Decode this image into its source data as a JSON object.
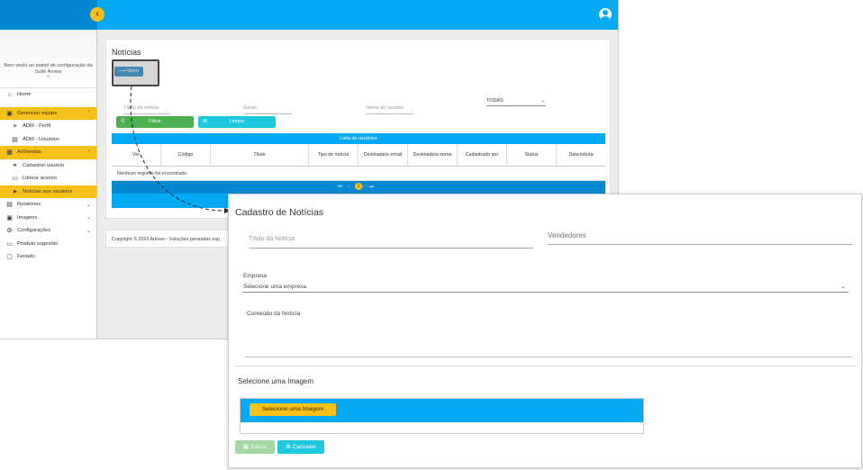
{
  "sidebar": {
    "welcome": "Bem vindo ao painel de configuração da Suite Arnew",
    "items": [
      {
        "label": "Home",
        "icon": "home-icon",
        "glyph": "⌂"
      },
      {
        "label": "Gerenciar equipe",
        "icon": "badge-icon",
        "glyph": "▣"
      },
      {
        "label": "ADM - Perfil",
        "icon": "list-icon",
        "glyph": "≡"
      },
      {
        "label": "ADM - Usuários",
        "icon": "user-card-icon",
        "glyph": "▤"
      },
      {
        "label": "ArtVendas",
        "icon": "store-icon",
        "glyph": "▦"
      },
      {
        "label": "Cadastrar usuário",
        "icon": "add-user-icon",
        "glyph": "⚭"
      },
      {
        "label": "Liberar acesso",
        "icon": "key-icon",
        "glyph": "▭"
      },
      {
        "label": "Notícias aos usuários",
        "icon": "send-icon",
        "glyph": "➤"
      },
      {
        "label": "Relatórios",
        "icon": "report-icon",
        "glyph": "▤"
      },
      {
        "label": "Imagens",
        "icon": "image-icon",
        "glyph": "▣"
      },
      {
        "label": "Configurações",
        "icon": "gear-icon",
        "glyph": "⚙"
      },
      {
        "label": "Produto sugestão",
        "icon": "product-icon",
        "glyph": "▭"
      },
      {
        "label": "Feriado",
        "icon": "calendar-icon",
        "glyph": "▢"
      }
    ]
  },
  "content": {
    "title": "Notícias",
    "new_button": "Novo",
    "filters": {
      "titulo_placeholder": "Título da notícia",
      "email_placeholder": "Email",
      "nome_placeholder": "Nome do usuário",
      "select_value": "TODAS"
    },
    "filter_button": "Filtrar",
    "clear_button": "Limpar",
    "table": {
      "title": "Lista de usuários",
      "columns": [
        "Ver",
        "Código",
        "Título",
        "Tipo de notícia",
        "Destinatário email",
        "Destinatário nome",
        "Cadastrado por",
        "Status",
        "Data leitura"
      ],
      "empty_message": "Nenhum registro foi encontrado.",
      "current_page": "1"
    }
  },
  "footer": {
    "text": "Copyright © 2023 Artnew - Soluções pensadas esp"
  },
  "modal": {
    "title": "Cadastro de Notícias",
    "titulo_placeholder": "Título da Notícia",
    "vendedores_placeholder": "Vendedores",
    "empresa_label": "Empresa",
    "empresa_value": "Selecione uma empresa",
    "conteudo_label": "Conteúdo da Notícia",
    "imagem_label": "Selecione uma Imagem",
    "imagem_button": "Selecione uma Imagem",
    "save_button": "Salvar",
    "cancel_button": "Cancelar"
  },
  "colors": {
    "primary": "#03a9f4",
    "accent": "#f6c21a",
    "success": "#4caf50",
    "info": "#1ec8e0"
  }
}
